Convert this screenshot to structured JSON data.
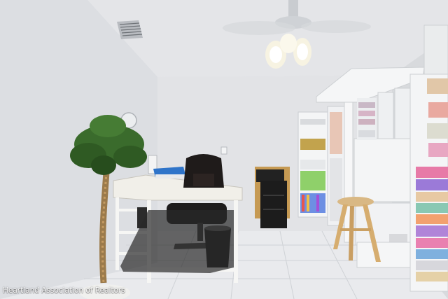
{
  "watermark": "Heartland Association of Realtors"
}
